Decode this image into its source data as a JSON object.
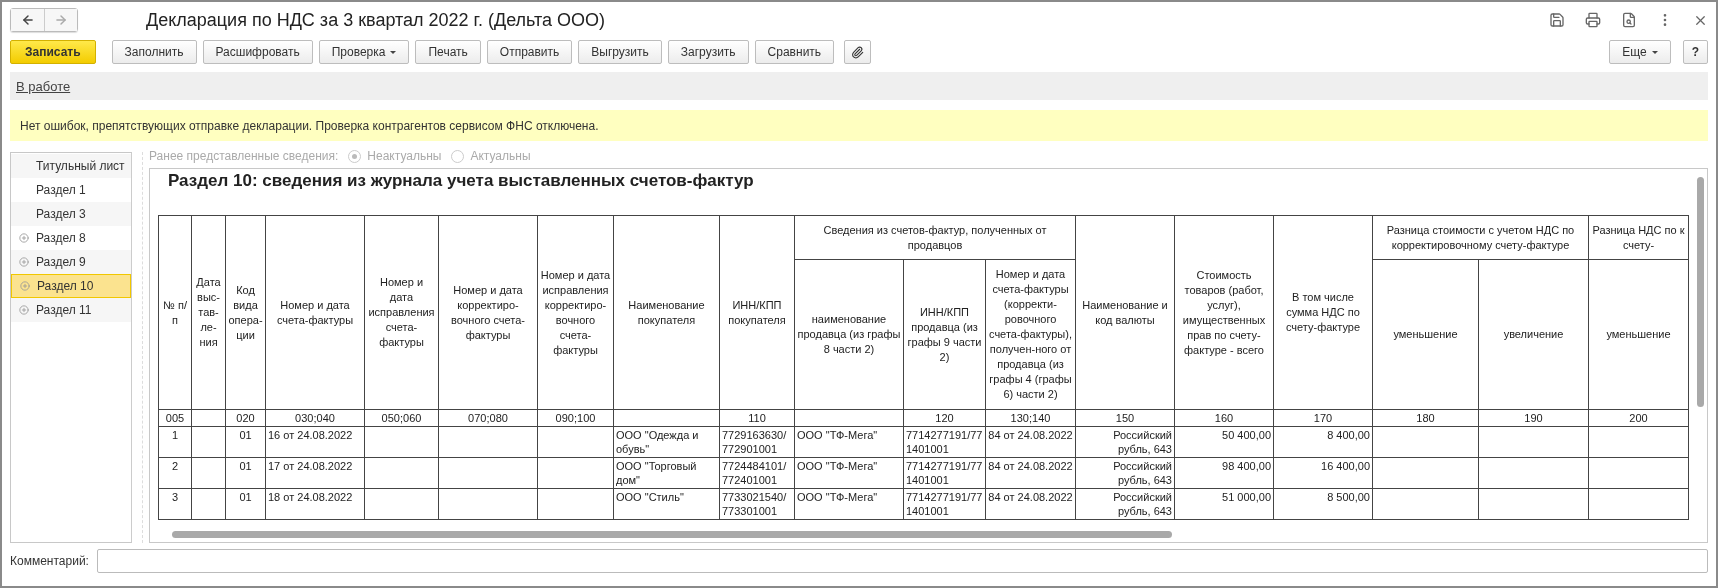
{
  "window": {
    "title": "Декларация по НДС за 3 квартал 2022 г. (Дельта ООО)",
    "nav": {
      "back_enabled": true,
      "forward_enabled": false
    }
  },
  "toolbar": [
    {
      "kind": "primary",
      "label": "Записать"
    },
    {
      "kind": "button",
      "label": "Заполнить"
    },
    {
      "kind": "button",
      "label": "Расшифровать"
    },
    {
      "kind": "dropdown",
      "label": "Проверка"
    },
    {
      "kind": "button",
      "label": "Печать"
    },
    {
      "kind": "button",
      "label": "Отправить"
    },
    {
      "kind": "button",
      "label": "Выгрузить"
    },
    {
      "kind": "button",
      "label": "Загрузить"
    },
    {
      "kind": "button",
      "label": "Сравнить"
    },
    {
      "kind": "attach"
    }
  ],
  "toolbar_right": [
    {
      "kind": "dropdown",
      "label": "Еще"
    },
    {
      "kind": "help",
      "label": "?"
    }
  ],
  "status_link": "В работе",
  "notice": "Нет ошибок, препятствующих отправке декларации. Проверка контрагентов сервисом ФНС отключена.",
  "sidebar": {
    "items": [
      {
        "label": "Титульный лист",
        "expandable": false,
        "selected": false
      },
      {
        "label": "Раздел 1",
        "expandable": false,
        "selected": false
      },
      {
        "label": "Раздел 3",
        "expandable": false,
        "selected": false
      },
      {
        "label": "Раздел 8",
        "expandable": true,
        "selected": false
      },
      {
        "label": "Раздел 9",
        "expandable": true,
        "selected": false
      },
      {
        "label": "Раздел 10",
        "expandable": true,
        "selected": true
      },
      {
        "label": "Раздел 11",
        "expandable": true,
        "selected": false
      }
    ]
  },
  "previous_info": {
    "label": "Ранее представленные сведения:",
    "disabled": true,
    "options": [
      {
        "label": "Неактуальны",
        "selected": true
      },
      {
        "label": "Актуальны",
        "selected": false
      }
    ]
  },
  "report": {
    "title": "Раздел 10: сведения из журнала учета выставленных счетов-фактур",
    "header": [
      {
        "label": "№ п/п",
        "code": "005"
      },
      {
        "label": "Дата выс-тав-ле-ния"
      },
      {
        "label": "Код вида опера-ции",
        "code": "020"
      },
      {
        "label": "Номер и дата счета-фактуры",
        "code": "030;040"
      },
      {
        "label": "Номер и дата исправления счета-фактуры",
        "code": "050;060"
      },
      {
        "label": "Номер и дата корректиро-вочного счета-фактуры",
        "code": "070;080"
      },
      {
        "label": "Номер и дата исправления корректиро-вочного счета-фактуры",
        "code": "090;100"
      },
      {
        "label": "Наименование покупателя"
      },
      {
        "label": "ИНН/КПП покупателя",
        "code": "110"
      },
      {
        "label": "Сведения из счетов-фактур, полученных от продавцов",
        "children": [
          {
            "label": "наименование продавца (из графы 8 части 2)"
          },
          {
            "label": "ИНН/КПП продавца (из графы 9 части 2)",
            "code": "120"
          },
          {
            "label": "Номер и дата счета-фактуры (корректи-ровочного счета-фактуры), получен-ного от продавца (из графы 4 (графы 6) части 2)",
            "code": "130;140"
          }
        ]
      },
      {
        "label": "Наименование и код валюты",
        "code": "150"
      },
      {
        "label": "Стоимость товаров (работ, услуг), имущественных прав по счету-фактуре - всего",
        "code": "160"
      },
      {
        "label": "В том числе сумма НДС по счету-фактуре",
        "code": "170"
      },
      {
        "label": "Разница стоимости с учетом НДС по корректировочному счету-фактуре",
        "children": [
          {
            "label": "уменьшение",
            "code": "180"
          },
          {
            "label": "увеличение",
            "code": "190"
          }
        ]
      },
      {
        "label": "Разница НДС по к\nсчету-",
        "children": [
          {
            "label": "уменьшение",
            "code": "200"
          }
        ]
      }
    ],
    "rows": [
      {
        "cells": [
          "1",
          null,
          "01",
          "16 от 24.08.2022",
          null,
          null,
          null,
          "ООО \"Одежда и обувь\"",
          "7729163630/772901001",
          "ООО \"ТФ-Мега\"",
          "7714277191/771401001",
          "84 от 24.08.2022",
          "Российский рубль, 643",
          "50 400,00",
          "8 400,00",
          null,
          null,
          null
        ]
      },
      {
        "cells": [
          "2",
          null,
          "01",
          "17 от 24.08.2022",
          null,
          null,
          null,
          "ООО \"Торговый дом\"",
          "7724484101/772401001",
          "ООО \"ТФ-Мега\"",
          "7714277191/771401001",
          "84 от 24.08.2022",
          "Российский рубль, 643",
          "98 400,00",
          "16 400,00",
          null,
          null,
          null
        ]
      },
      {
        "cells": [
          "3",
          null,
          "01",
          "18 от 24.08.2022",
          null,
          null,
          null,
          "ООО \"Стиль\"",
          "7733021540/773301001",
          "ООО \"ТФ-Мега\"",
          "7714277191/771401001",
          "84 от 24.08.2022",
          "Российский рубль, 643",
          "51 000,00",
          "8 500,00",
          null,
          null,
          null
        ]
      }
    ]
  },
  "comment": {
    "label": "Комментарий:"
  }
}
